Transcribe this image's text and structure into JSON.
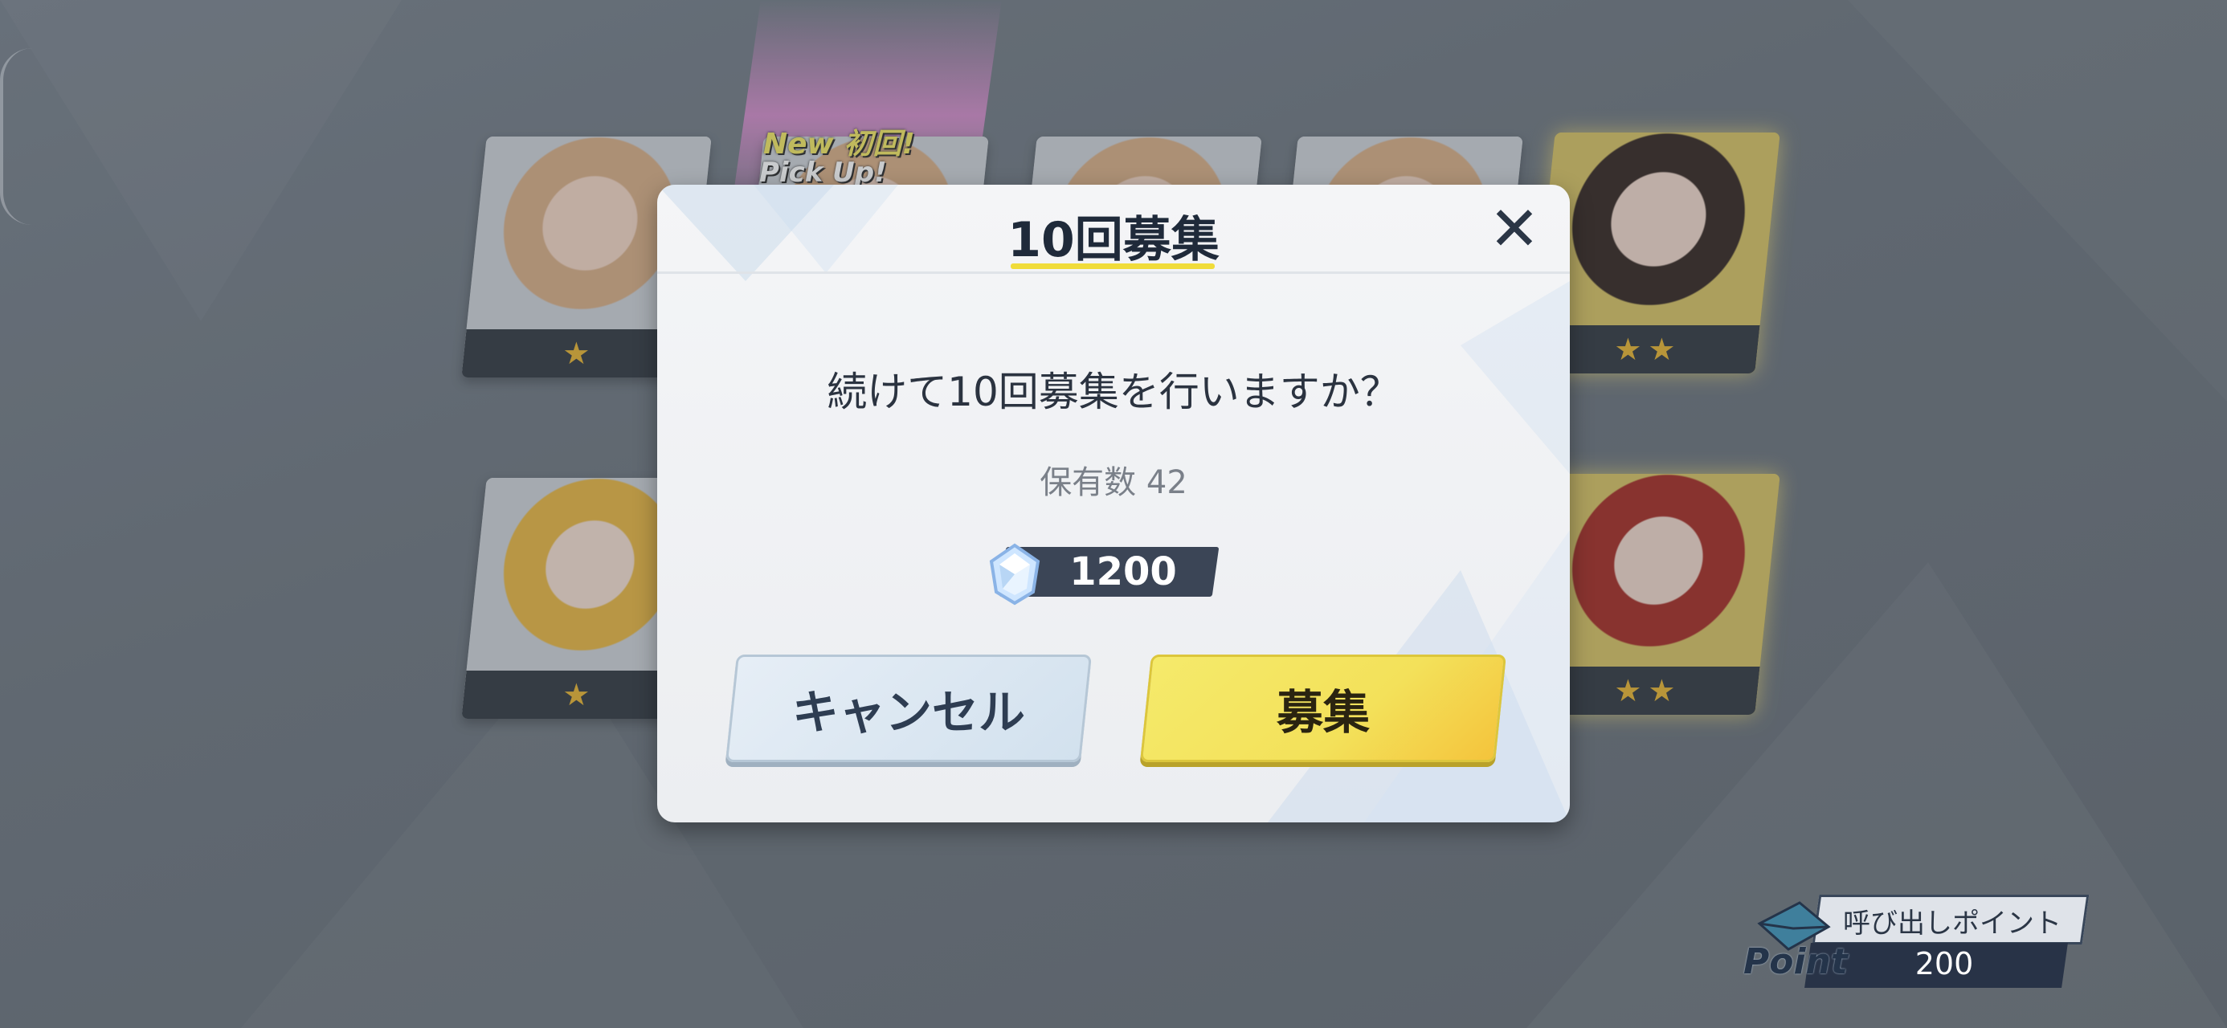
{
  "background": {
    "cards": [
      {
        "name": "card-glasses-girl",
        "stars": 1,
        "variant": "normal"
      },
      {
        "name": "card-pickup-girl",
        "stars": 0,
        "variant": "normal"
      },
      {
        "name": "card-maid-girl",
        "stars": 0,
        "variant": "normal"
      },
      {
        "name": "card-cat-ear-girl",
        "stars": 0,
        "variant": "normal"
      },
      {
        "name": "card-black-hair-girl",
        "stars": 2,
        "variant": "gold"
      },
      {
        "name": "card-blonde-girl",
        "stars": 1,
        "variant": "blonde"
      },
      {
        "name": "card-red-hair-girl",
        "stars": 2,
        "variant": "gold-red"
      }
    ],
    "pickup_badge": {
      "new": "New 初回!",
      "pickup": "Pick Up!"
    }
  },
  "dialog": {
    "title": "10回募集",
    "close_icon": "close-icon",
    "question": "続けて10回募集を行いますか？",
    "owned": "保有数 42",
    "cost_value": "1200",
    "currency_icon": "crystal-gem-icon",
    "cancel_label": "キャンセル",
    "confirm_label": "募集"
  },
  "point_widget": {
    "label": "呼び出しポイント",
    "value": "200",
    "word": "Point",
    "icon": "envelope-icon"
  },
  "colors": {
    "accent_yellow": "#f3e15a",
    "dark_navy": "#283347",
    "star_gold": "#e8b73a"
  }
}
